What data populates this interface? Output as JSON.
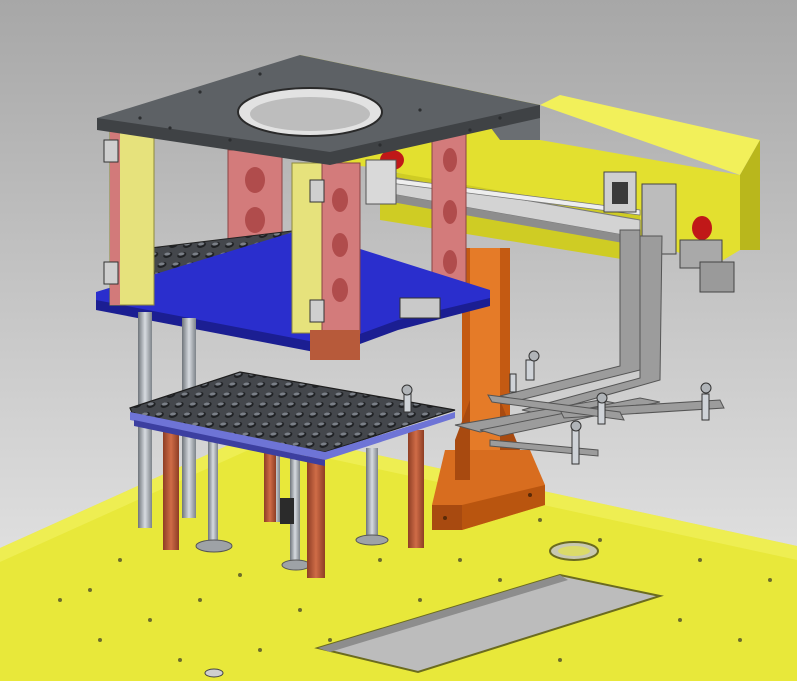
{
  "scene": {
    "kind": "cad-3d-assembly-view",
    "colors": {
      "background_top": "#a8a8a8",
      "background_bottom": "#e6e6e6",
      "base_plate": "#e6e637",
      "top_plate": "#5a5e62",
      "column_pink": "#d27a7a",
      "column_yellow": "#e5e27a",
      "blue_plate": "#2327c8",
      "copper_post": "#b75a3a",
      "orange_bracket": "#d2691e",
      "steel": "#9aa0a6",
      "tray": "#3f4247",
      "rail": "#c9c9c9"
    }
  }
}
